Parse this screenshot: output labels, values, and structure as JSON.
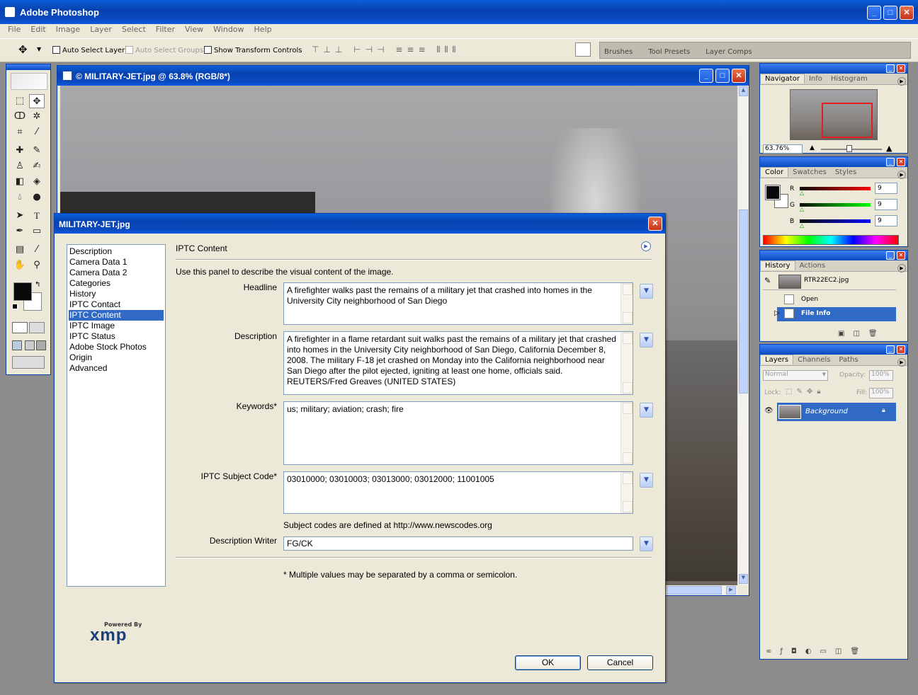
{
  "app": {
    "title": "Adobe Photoshop",
    "menu": [
      "File",
      "Edit",
      "Image",
      "Layer",
      "Select",
      "Filter",
      "View",
      "Window",
      "Help"
    ]
  },
  "options_bar": {
    "auto_select_layer": "Auto Select Layer",
    "auto_select_groups": "Auto Select Groups",
    "show_transform": "Show Transform Controls",
    "well_tabs": [
      "Brushes",
      "Tool Presets",
      "Layer Comps"
    ]
  },
  "document": {
    "title": "© MILITARY-JET.jpg @ 63.8% (RGB/8*)"
  },
  "navigator": {
    "tabs": [
      "Navigator",
      "Info",
      "Histogram"
    ],
    "zoom": "63.76%"
  },
  "color": {
    "tabs": [
      "Color",
      "Swatches",
      "Styles"
    ],
    "r_label": "R",
    "g_label": "G",
    "b_label": "B",
    "r": "9",
    "g": "9",
    "b": "9"
  },
  "history": {
    "tabs": [
      "History",
      "Actions"
    ],
    "snapshot": "RTR22EC2.jpg",
    "items": [
      "Open",
      "File Info"
    ]
  },
  "layers": {
    "tabs": [
      "Layers",
      "Channels",
      "Paths"
    ],
    "blend_mode": "Normal",
    "opacity_label": "Opacity:",
    "opacity": "100%",
    "lock_label": "Lock:",
    "fill_label": "Fill:",
    "fill": "100%",
    "layer_name": "Background"
  },
  "dialog": {
    "title": "MILITARY-JET.jpg",
    "categories": [
      "Description",
      "Camera Data 1",
      "Camera Data 2",
      "Categories",
      "History",
      "IPTC Contact",
      "IPTC Content",
      "IPTC Image",
      "IPTC Status",
      "Adobe Stock Photos",
      "Origin",
      "Advanced"
    ],
    "selected_category": "IPTC Content",
    "section_title": "IPTC Content",
    "intro": "Use this panel to describe the visual content of the image.",
    "headline_label": "Headline",
    "headline": "A firefighter walks past the remains of a military jet that crashed into homes in the University City neighborhood of San Diego",
    "description_label": "Description",
    "description": "A firefighter in a flame retardant suit walks past the remains of a military jet that crashed into homes in the University City neighborhood of San Diego, California December 8, 2008. The military F-18 jet crashed on Monday into the California neighborhood near San Diego after the pilot ejected, igniting at least one home, officials said.  REUTERS/Fred Greaves (UNITED STATES)",
    "keywords_label": "Keywords*",
    "keywords": "us; military; aviation; crash; fire",
    "subject_code_label": "IPTC Subject Code*",
    "subject_code": "03010000; 03010003; 03013000; 03012000; 11001005",
    "subject_note": "Subject codes are defined at http://www.newscodes.org",
    "writer_label": "Description Writer",
    "writer": "FG/CK",
    "footnote": "* Multiple values may be separated by a comma or semicolon.",
    "xmp_powered": "Powered By",
    "xmp_logo": "xmp",
    "ok": "OK",
    "cancel": "Cancel"
  }
}
